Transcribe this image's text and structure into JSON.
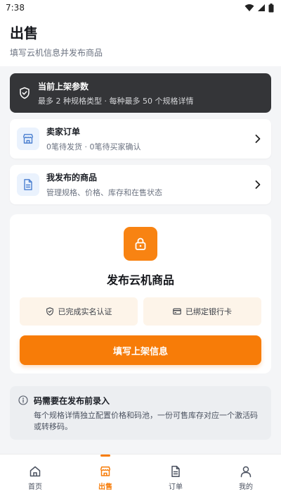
{
  "status_bar": {
    "time": "7:38"
  },
  "header": {
    "title": "出售",
    "subtitle": "填写云机信息并发布商品"
  },
  "banner": {
    "title": "当前上架参数",
    "desc": "最多 2 种规格类型 · 每种最多 50 个规格详情",
    "icon": "shield-icon"
  },
  "cards": [
    {
      "title": "卖家订单",
      "desc": "0笔待发货 · 0笔待买家确认",
      "icon": "store-icon"
    },
    {
      "title": "我发布的商品",
      "desc": "管理规格、价格、库存和在售状态",
      "icon": "document-icon"
    }
  ],
  "publish": {
    "title": "发布云机商品",
    "badges": [
      {
        "label": "已完成实名认证",
        "icon": "shield-check-icon"
      },
      {
        "label": "已绑定银行卡",
        "icon": "bank-card-icon"
      }
    ],
    "button_label": "填写上架信息"
  },
  "notice": {
    "title": "码需要在发布前录入",
    "desc": "每个规格详情独立配置价格和码池，一份可售库存对应一个激活码或转移码。"
  },
  "tabs": [
    {
      "label": "首页",
      "icon": "home-icon",
      "active": false
    },
    {
      "label": "出售",
      "icon": "store-icon",
      "active": true
    },
    {
      "label": "订单",
      "icon": "document-icon",
      "active": false
    },
    {
      "label": "我的",
      "icon": "user-icon",
      "active": false
    }
  ],
  "colors": {
    "accent": "#f77c08",
    "banner_bg": "#343538",
    "card_icon_bg": "#eaf2fd",
    "icon_blue": "#4a7fd0"
  }
}
